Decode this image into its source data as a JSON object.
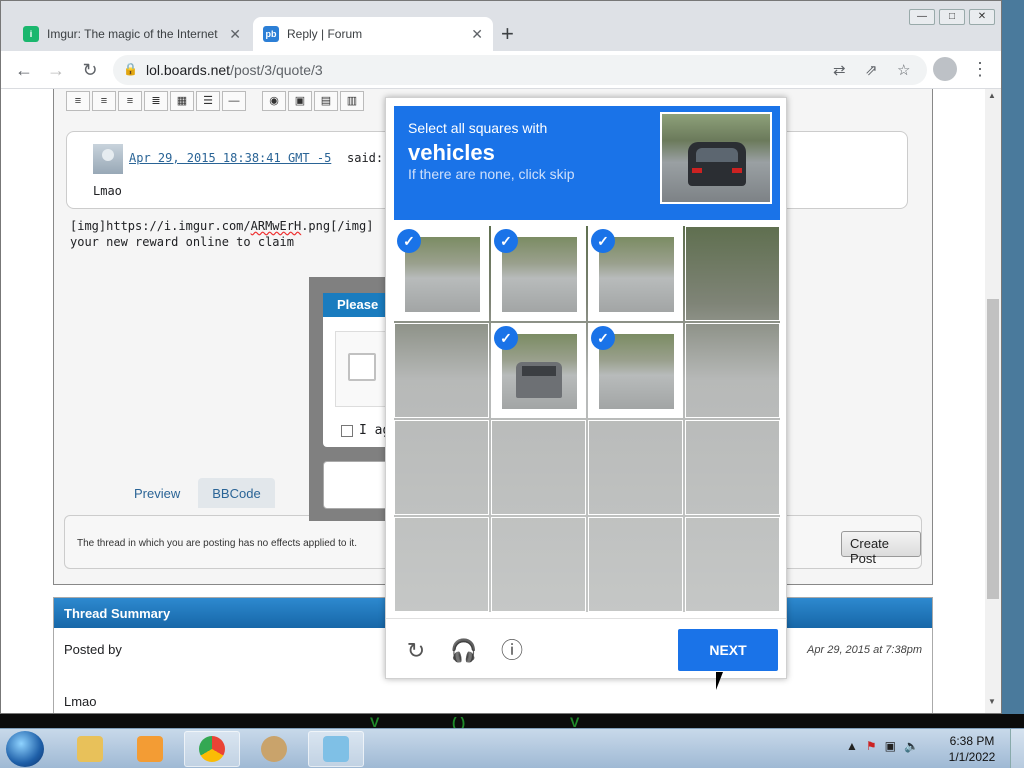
{
  "browser": {
    "tabs": [
      {
        "title": "Imgur: The magic of the Internet",
        "active": false
      },
      {
        "title": "Reply | Forum",
        "active": true
      }
    ],
    "url_host": "lol.boards.net",
    "url_path": "/post/3/quote/3"
  },
  "forum": {
    "quote": {
      "date": "Apr 29, 2015 18:38:41 GMT -5",
      "said": "said:",
      "text": "Lmao"
    },
    "post_lines": [
      "[img]https://i.imgur.com/ARMwErH.png[/img]",
      "your new reward online to claim"
    ],
    "behind_modal": {
      "title": "Please",
      "agree_text": "I ag"
    },
    "editor_tabs": [
      "Preview",
      "BBCode"
    ],
    "notice": "The thread in which you are posting has no effects applied to it.",
    "create_post": "Create Post",
    "summary": {
      "heading": "Thread Summary",
      "posted_by": "Posted by",
      "date": "Apr 29, 2015 at 7:38pm",
      "message": "Lmao"
    }
  },
  "captcha": {
    "instruction": "Select all squares with",
    "target": "vehicles",
    "hint": "If there are none, click skip",
    "selected_cells": [
      0,
      1,
      2,
      5,
      6
    ],
    "next_label": "NEXT",
    "footer_icons": [
      "reload-icon",
      "audio-icon",
      "info-icon"
    ]
  },
  "taskbar": {
    "time": "6:38 PM",
    "date": "1/1/2022"
  }
}
